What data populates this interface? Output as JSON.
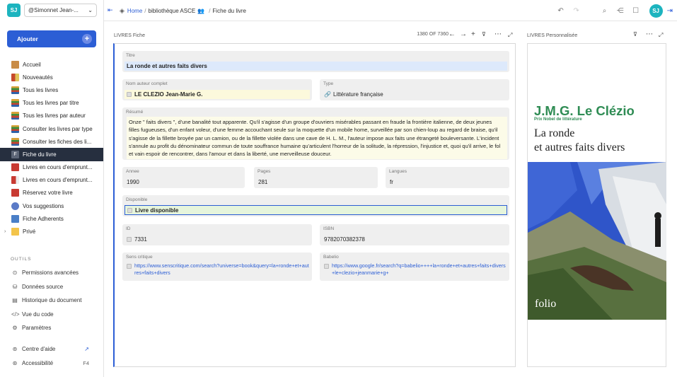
{
  "workspace": {
    "avatar": "SJ",
    "name": "@Simonnet Jean-..."
  },
  "add_button": "Ajouter",
  "nav": [
    {
      "label": "Accueil",
      "icon": "home"
    },
    {
      "label": "Nouveautés",
      "icon": "new"
    },
    {
      "label": "Tous les livres",
      "icon": "book"
    },
    {
      "label": "Tous les livres par titre",
      "icon": "book"
    },
    {
      "label": "Tous les livres par auteur",
      "icon": "book"
    },
    {
      "label": "Consulter les livres par type",
      "icon": "book"
    },
    {
      "label": "Consulter les fiches des li...",
      "icon": "book"
    },
    {
      "label": "Fiche du livre",
      "icon": "f"
    },
    {
      "label": "Livres en cours d'emprunt...",
      "icon": "red"
    },
    {
      "label": "Livres en cours d'emprunt...",
      "icon": "redw"
    },
    {
      "label": "Réservez votre livre",
      "icon": "red"
    },
    {
      "label": "Vos suggestions",
      "icon": "user"
    },
    {
      "label": "Fiche Adherents",
      "icon": "people"
    },
    {
      "label": "Privé",
      "icon": "folder"
    }
  ],
  "tools_title": "OUTILS",
  "tools": [
    {
      "label": "Permissions avancées",
      "icon": "⊙"
    },
    {
      "label": "Données source",
      "icon": "⛁"
    },
    {
      "label": "Historique du document",
      "icon": "▤"
    },
    {
      "label": "Vue du code",
      "icon": "</>"
    },
    {
      "label": "Paramètres",
      "icon": "⚙"
    }
  ],
  "bottom": {
    "help": "Centre d'aide",
    "access": "Accessibilité",
    "access_key": "F4"
  },
  "breadcrumb": {
    "home": "Home",
    "doc": "bibliothèque ASCE",
    "page": "Fiche du livre"
  },
  "user_avatar": "SJ",
  "main": {
    "title": "LIVRES Fiche",
    "pager": "1380 OF 7360",
    "fields": {
      "titre": {
        "label": "Titre",
        "value": "La ronde et autres faits divers"
      },
      "auteur": {
        "label": "Nom auteur complet",
        "value": "LE CLEZIO Jean-Marie G."
      },
      "type": {
        "label": "Type",
        "value": "Littérature française"
      },
      "resume": {
        "label": "Résumé",
        "value": "Onze \" faits divers \", d'une banalité tout apparente. Qu'il s'agisse d'un groupe d'ouvriers misérables passant en fraude la frontière italienne, de deux jeunes filles fugueuses, d'un enfant voleur, d'une femme accouchant seule sur la moquette d'un mobile home, surveillée par son chien-loup au regard de braise, qu'il s'agisse de la fillette broyée par un camion, ou de la fillette violée dans une cave de H. L. M., l'auteur impose aux faits une étrangeté bouleversante. L'incident s'annule au profit du dénominateur commun de toute souffrance humaine qu'articulent l'horreur de la solitude, la répression, l'injustice et, quoi qu'il arrive, le fol et vain espoir de rencontrer, dans l'amour et dans la liberté, une merveilleuse douceur."
      },
      "annee": {
        "label": "Annee",
        "value": "1990"
      },
      "pages": {
        "label": "Pages",
        "value": "281"
      },
      "langues": {
        "label": "Langues",
        "value": "fr"
      },
      "disponible": {
        "label": "Disponible",
        "value": "Livre disponible"
      },
      "id": {
        "label": "ID",
        "value": "7331"
      },
      "isbn": {
        "label": "ISBN",
        "value": "9782070382378"
      },
      "sens": {
        "label": "Sens critique",
        "value": "https://www.senscritique.com/search?universe=book&query=la+ronde+et+autres+faits+divers"
      },
      "babelio": {
        "label": "Babelio",
        "value": "https://www.google.fr/search?q=babelio++++la+ronde+et+autres+faits+divers+le+clezio+jeanmarie+g+"
      }
    }
  },
  "right": {
    "title": "LIVRES Personnalisée",
    "cover": {
      "author": "J.M.G. Le Clézio",
      "prize": "Prix Nobel de littérature",
      "title_line1": "La ronde",
      "title_line2": "et autres faits divers",
      "publisher": "folio"
    }
  },
  "colors": {
    "accent": "#2c5ed5",
    "active_nav": "#262f3f",
    "cover_green": "#2f8c54"
  }
}
